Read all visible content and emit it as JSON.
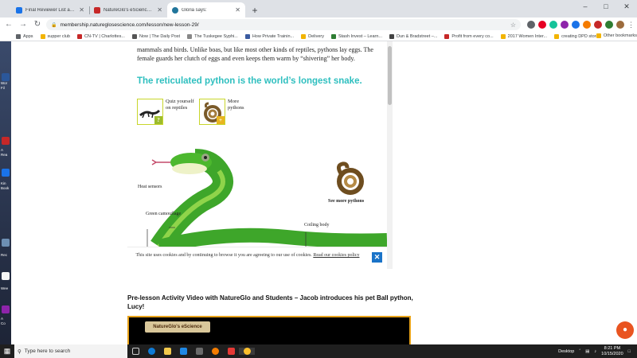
{
  "tabs": [
    {
      "title": "Final Reviewer List and Vendor Re",
      "color": "#1a73e8"
    },
    {
      "title": "NatureGlo's eScience – Homeschool",
      "color": "#c62828"
    },
    {
      "title": "Gloria says:",
      "color": "#21759b",
      "active": true
    }
  ],
  "window": {
    "minimize": "–",
    "maximize": "□",
    "close": "✕",
    "new_tab": "+"
  },
  "toolbar": {
    "back": "←",
    "forward": "→",
    "reload": "↻",
    "url": "membership.natureglosescience.com/lesson/new-lesson-29/",
    "lock": "🔒",
    "star": "☆",
    "menu": "⋮"
  },
  "bookmarks": [
    {
      "label": "Apps",
      "color": "#5f6368"
    },
    {
      "label": "supper club",
      "color": "#f2b400"
    },
    {
      "label": "CN-TV | Charlottes...",
      "color": "#c62828"
    },
    {
      "label": "Now | The Daily Post",
      "color": "#555"
    },
    {
      "label": "The Tuskegee Syphi...",
      "color": "#888"
    },
    {
      "label": "How Private Trainin...",
      "color": "#3a5ba0"
    },
    {
      "label": "Delivery",
      "color": "#f2b400"
    },
    {
      "label": "Stash Invest – Learn...",
      "color": "#2e7d32"
    },
    {
      "label": "Dun & Bradstreet –...",
      "color": "#444"
    },
    {
      "label": "Profit from every co...",
      "color": "#c62828"
    },
    {
      "label": "2017 Women Inter...",
      "color": "#f2b400"
    },
    {
      "label": "creating DPD store",
      "color": "#f2b400"
    }
  ],
  "bookmarks_more": "»",
  "other_bookmarks": "Other bookmarks",
  "article": {
    "intro": "mammals and birds. Unlike boas, but like most other kinds of reptiles, pythons lay eggs. The female guards her clutch of eggs and even keeps them warm by “shivering” her body.",
    "headline": "The reticulated python is the world’s longest snake.",
    "card_quiz": {
      "line1": "Quiz yourself",
      "line2": "on reptiles",
      "badge": "?"
    },
    "card_more": {
      "line1": "More",
      "line2": "pythons",
      "badge": "+"
    },
    "labels": {
      "heat": "Heat sensors",
      "camo": "Green camouflage",
      "coiling": "Coiling body",
      "see_more": "See more pythons"
    }
  },
  "cookie": {
    "text": "This site uses cookies and by continuing to browse it you are agreeing to our use of cookies.",
    "link": "Read our cookies policy",
    "close": "✕"
  },
  "video": {
    "title": "Pre-lesson Activity Video with NatureGlo and Students – Jacob introduces his pet Ball python, Lucy!",
    "logo": "NatureGlo's eScience"
  },
  "desktop_labels": [
    "Wor",
    "Fil",
    "A",
    "Rea",
    "Kin",
    "Book",
    "Rec",
    "Wee",
    "A",
    "Co"
  ],
  "taskbar": {
    "search": "Type here to search",
    "desktop": "Desktop",
    "time": "8:21 PM",
    "date": "10/15/2020"
  },
  "colors": {
    "accent": "#2ebfbf",
    "cookie_close": "#1a73c8",
    "video_border": "#e8a31a",
    "chat": "#e95420"
  }
}
